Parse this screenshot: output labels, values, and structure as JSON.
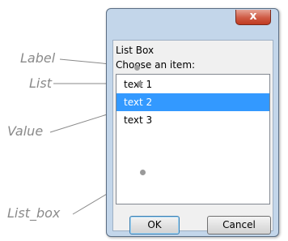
{
  "annotations": {
    "label": "Label",
    "list": "List",
    "value": "Value",
    "list_box": "List_box"
  },
  "window": {
    "close_glyph": "x",
    "group_title": "List Box",
    "prompt": "Choose an item:",
    "items": [
      "text 1",
      "text 2",
      "text 3"
    ],
    "selected_item": "text 2",
    "ok_label": "OK",
    "cancel_label": "Cancel"
  }
}
